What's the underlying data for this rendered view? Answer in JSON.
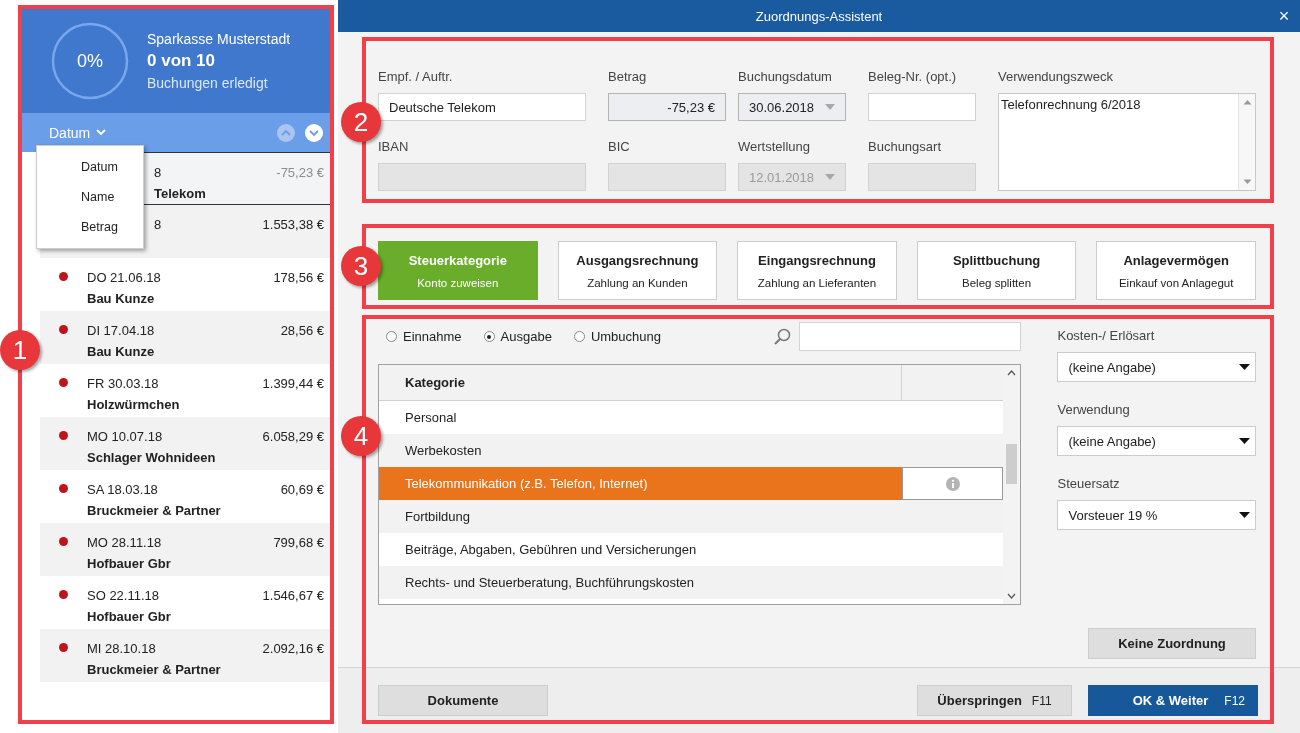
{
  "sidebar": {
    "progress": {
      "label": "0%"
    },
    "bank": "Sparkasse Musterstadt",
    "count": "0 von 10",
    "subtitle": "Buchungen erledigt",
    "sort": {
      "label": "Datum",
      "menu": [
        {
          "label": "Datum"
        },
        {
          "label": "Name"
        },
        {
          "label": "Betrag"
        }
      ]
    },
    "transactions": [
      {
        "kind": "covered",
        "date": "8",
        "name": "Telekom",
        "amount": "-75,23 €",
        "selected": true
      },
      {
        "kind": "covered",
        "date": "8",
        "amount": "1.553,38 €",
        "selected": false
      },
      {
        "kind": "open",
        "date": "DO 21.06.18",
        "name": "Bau Kunze",
        "amount": "178,56 €",
        "selected": false,
        "color": "#c0141c"
      },
      {
        "kind": "open",
        "date": "DI 17.04.18",
        "name": "Bau Kunze",
        "amount": "28,56 €",
        "selected": false,
        "color": "#c0141c"
      },
      {
        "kind": "open",
        "date": "FR 30.03.18",
        "name": "Holzwürmchen",
        "amount": "1.399,44 €",
        "selected": false,
        "color": "#c0141c"
      },
      {
        "kind": "open",
        "date": "MO 10.07.18",
        "name": "Schlager Wohnideen",
        "amount": "6.058,29 €",
        "selected": false,
        "color": "#c0141c"
      },
      {
        "kind": "open",
        "date": "SA 18.03.18",
        "name": "Bruckmeier & Partner",
        "amount": "60,69 €",
        "selected": false,
        "color": "#c0141c"
      },
      {
        "kind": "open",
        "date": "MO 28.11.18",
        "name": "Hofbauer Gbr",
        "amount": "799,68 €",
        "selected": false,
        "color": "#c0141c"
      },
      {
        "kind": "open",
        "date": "SO 22.11.18",
        "name": "Hofbauer Gbr",
        "amount": "1.546,67 €",
        "selected": false,
        "color": "#c0141c"
      },
      {
        "kind": "open",
        "date": "MI 28.10.18",
        "name": "Bruckmeier & Partner",
        "amount": "2.092,16 €",
        "selected": false,
        "color": "#c0141c"
      }
    ]
  },
  "window": {
    "title": "Zuordnungs-Assistent",
    "close": "×"
  },
  "booking_fields": [
    {
      "label": "Empf. / Auftr.",
      "kind": "text",
      "value": "Deutsche Telekom",
      "readonly": false,
      "disabled": false
    },
    {
      "label": "Betrag",
      "kind": "amount",
      "value": "-75,23 €",
      "readonly": true,
      "disabled": false
    },
    {
      "label": "Buchungsdatum",
      "kind": "select",
      "value": "30.06.2018",
      "readonly": true,
      "disabled": false
    },
    {
      "label": "Beleg-Nr. (opt.)",
      "kind": "text",
      "readonly": false,
      "disabled": false
    },
    {
      "label": "Verwendungszweck",
      "kind": "textarea",
      "value": "Telefonrechnung 6/2018",
      "readonly": false,
      "disabled": false
    },
    {
      "label": "IBAN",
      "kind": "text",
      "readonly": false,
      "disabled": true
    },
    {
      "label": "BIC",
      "kind": "text",
      "readonly": false,
      "disabled": true
    },
    {
      "label": "Wertstellung",
      "kind": "select",
      "value": "12.01.2018",
      "readonly": false,
      "disabled": true
    },
    {
      "label": "Buchungsart",
      "kind": "text",
      "readonly": false,
      "disabled": true
    }
  ],
  "assignment_tabs": [
    {
      "title": "Steuerkategorie",
      "subtitle": "Konto zuweisen",
      "selected": true
    },
    {
      "title": "Ausgangsrechnung",
      "subtitle": "Zahlung an Kunden",
      "selected": false
    },
    {
      "title": "Eingangsrechnung",
      "subtitle": "Zahlung an Lieferanten",
      "selected": false
    },
    {
      "title": "Splittbuchung",
      "subtitle": "Beleg splitten",
      "selected": false
    },
    {
      "title": "Anlagevermögen",
      "subtitle": "Einkauf von Anlagegut",
      "selected": false
    }
  ],
  "booking_type": [
    {
      "label": "Einnahme",
      "selected": false
    },
    {
      "label": "Ausgabe",
      "selected": true
    },
    {
      "label": "Umbuchung",
      "selected": false
    }
  ],
  "category_table": {
    "columns": [
      "Kategorie"
    ],
    "rows": [
      {
        "label": "Personal",
        "selected": false
      },
      {
        "label": "Werbekosten",
        "selected": false
      },
      {
        "label": "Telekommunikation (z.B. Telefon, Internet)",
        "selected": true
      },
      {
        "label": "Fortbildung",
        "selected": false
      },
      {
        "label": "Beiträge, Abgaben, Gebühren und Versicherungen",
        "selected": false
      },
      {
        "label": "Rechts- und Steuerberatung, Buchführungskosten",
        "selected": false
      }
    ]
  },
  "options": [
    {
      "label": "Kosten-/ Erlösart",
      "value": "(keine Angabe)"
    },
    {
      "label": "Verwendung",
      "value": "(keine Angabe)"
    },
    {
      "label": "Steuersatz",
      "value": "Vorsteuer 19 %"
    }
  ],
  "no_assignment_button": "Keine Zuordnung",
  "footer_buttons": [
    {
      "kind": "plain",
      "label": "Dokumente"
    },
    {
      "kind": "plain",
      "label": "Überspringen",
      "key": "F11"
    },
    {
      "kind": "primary",
      "label": "OK & Weiter",
      "key": "F12"
    }
  ],
  "annotations": [
    {
      "number": "1"
    },
    {
      "number": "2"
    },
    {
      "number": "3"
    },
    {
      "number": "4"
    }
  ]
}
